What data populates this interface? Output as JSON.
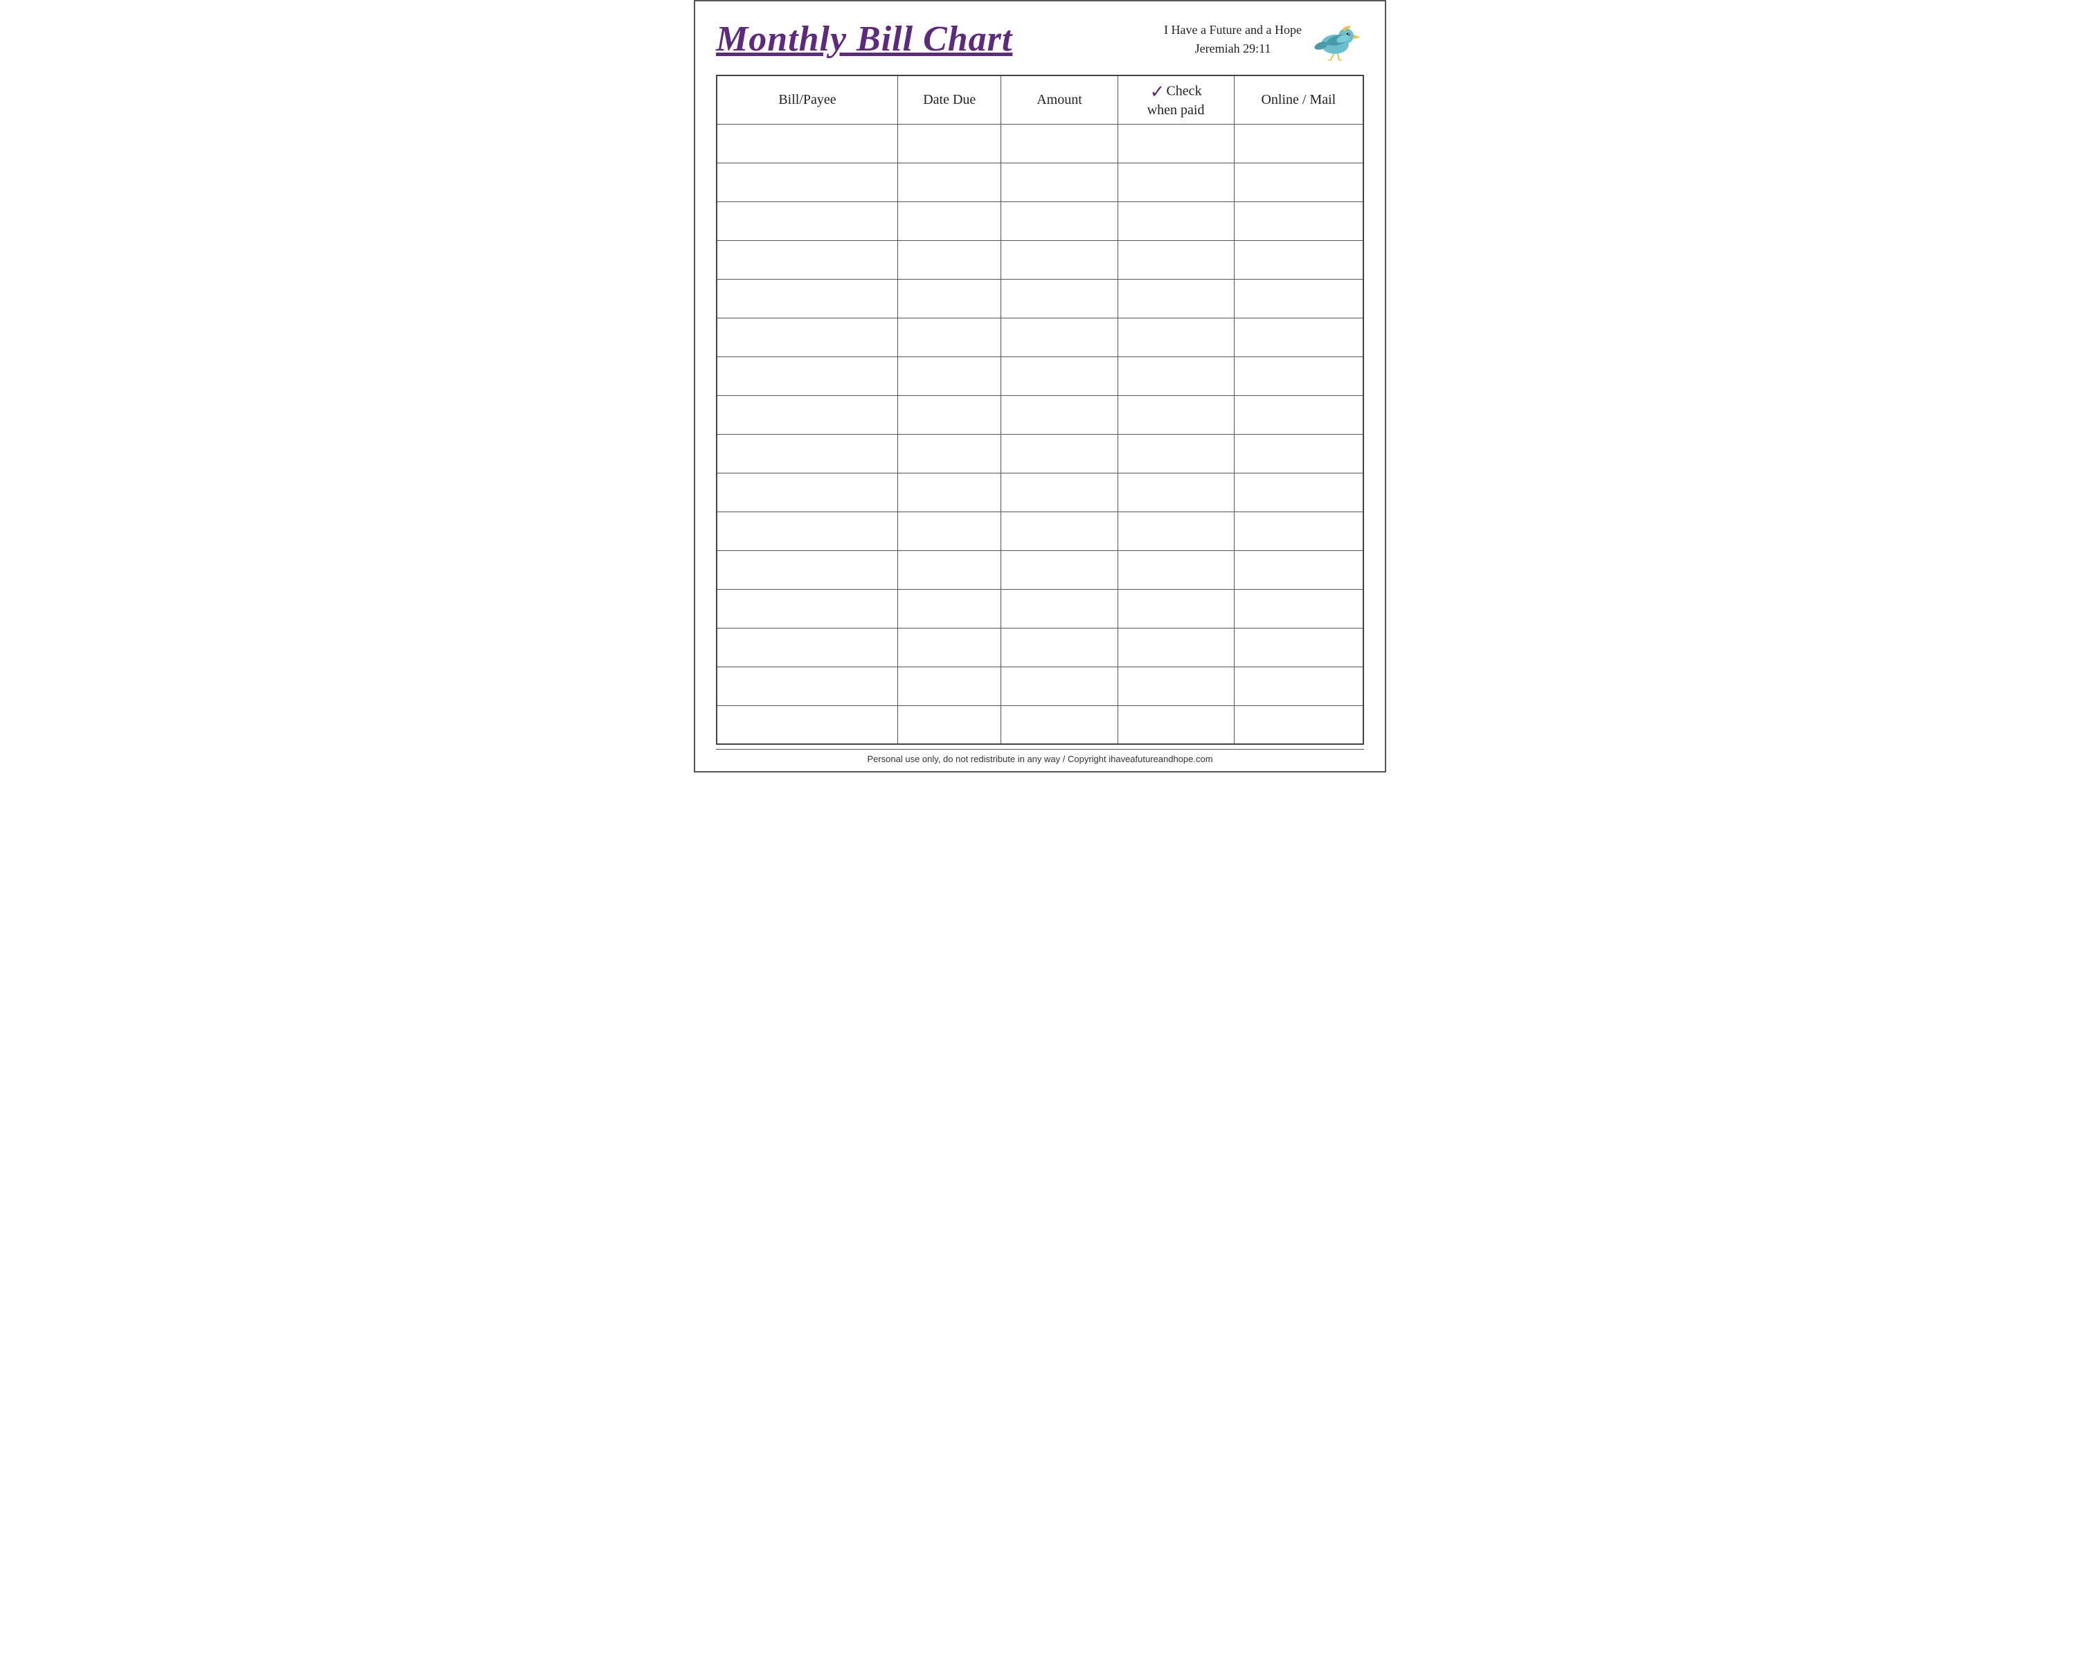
{
  "header": {
    "title": "Monthly Bill Chart",
    "tagline_line1": "I Have a Future and a Hope",
    "tagline_line2": "Jeremiah 29:11"
  },
  "table": {
    "columns": [
      {
        "id": "payee",
        "label": "Bill/Payee"
      },
      {
        "id": "date",
        "label": "Date Due"
      },
      {
        "id": "amount",
        "label": "Amount"
      },
      {
        "id": "check",
        "label": "Check\nwhen paid",
        "has_checkmark": true
      },
      {
        "id": "online",
        "label": "Online / Mail"
      }
    ],
    "row_count": 16
  },
  "footer": {
    "text": "Personal use only, do not redistribute in any way / Copyright ihaveafutureandhope.com"
  },
  "colors": {
    "title": "#5c2a7e",
    "border": "#555555",
    "checkmark": "#5c2a7e",
    "bird_body": "#6bbfcc",
    "bird_wing": "#4a9aaa",
    "bird_beak": "#f0c040"
  }
}
